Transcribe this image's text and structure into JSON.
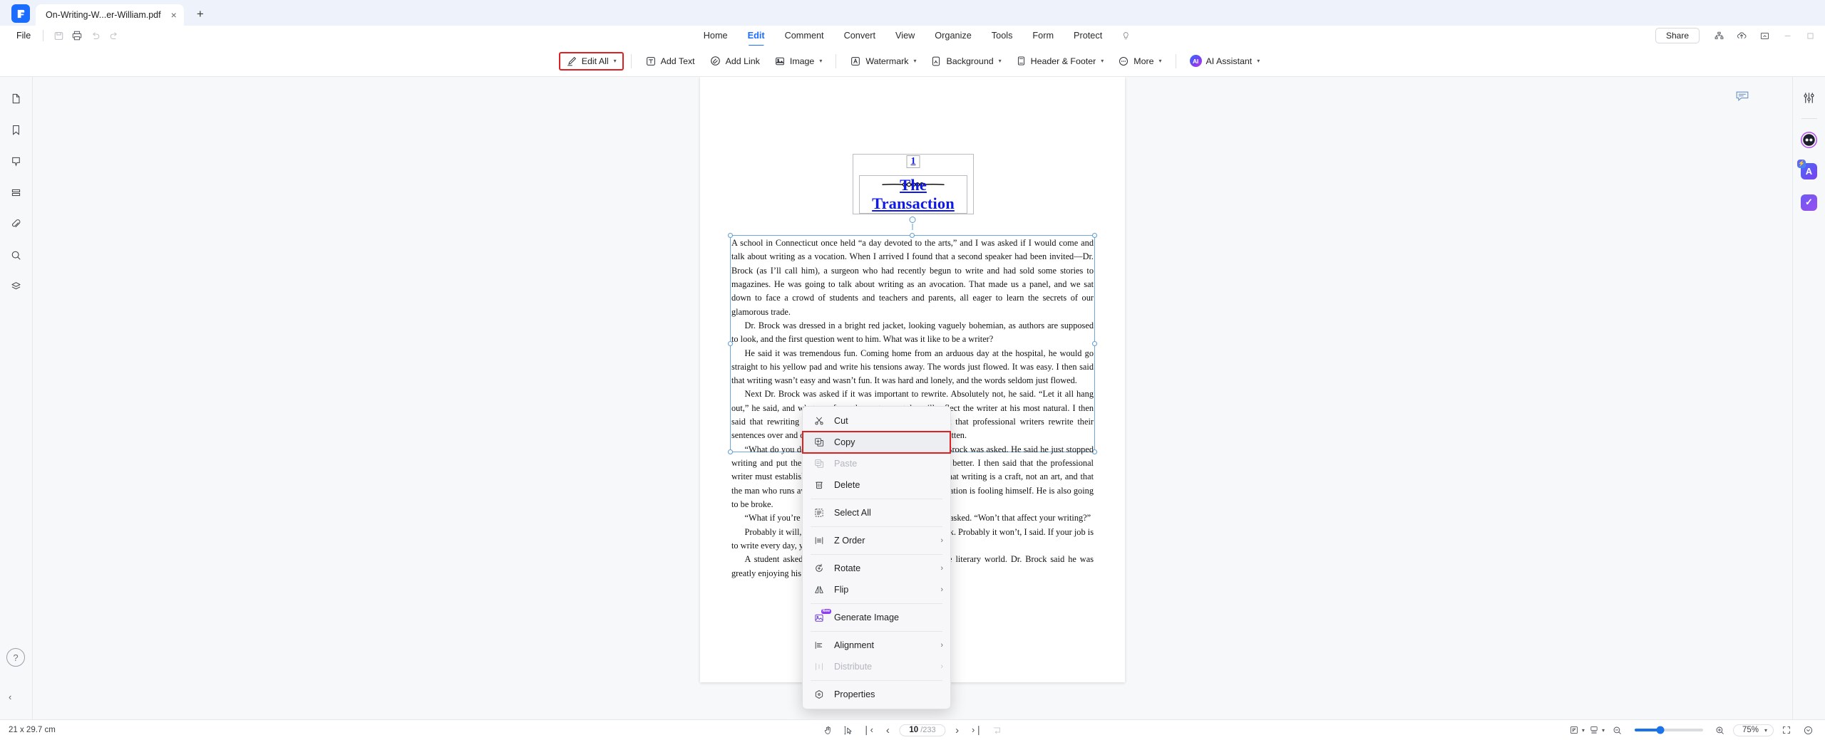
{
  "window": {
    "tab_title": "On-Writing-W...er-William.pdf",
    "close_label": "×",
    "new_tab_label": "+"
  },
  "menubar": {
    "file_label": "File",
    "quick_actions": [
      "save-icon",
      "print-icon",
      "undo-icon",
      "redo-icon"
    ],
    "tabs": [
      {
        "label": "Home",
        "active": false
      },
      {
        "label": "Edit",
        "active": true
      },
      {
        "label": "Comment",
        "active": false
      },
      {
        "label": "Convert",
        "active": false
      },
      {
        "label": "View",
        "active": false
      },
      {
        "label": "Organize",
        "active": false
      },
      {
        "label": "Tools",
        "active": false
      },
      {
        "label": "Form",
        "active": false
      },
      {
        "label": "Protect",
        "active": false
      }
    ],
    "tip_icon": "lightbulb-icon",
    "share_label": "Share",
    "window_icons": [
      "org-chart-icon",
      "cloud-upload-icon",
      "minimize-icon",
      "maximize-icon",
      "close-window-icon"
    ]
  },
  "toolbar": {
    "items": [
      {
        "label": "Edit All",
        "icon": "edit-pen-icon",
        "caret": true,
        "highlighted": true
      },
      {
        "label": "Add Text",
        "icon": "add-text-icon",
        "caret": false
      },
      {
        "label": "Add Link",
        "icon": "add-link-icon",
        "caret": false
      },
      {
        "label": "Image",
        "icon": "image-icon",
        "caret": true
      },
      {
        "label": "Watermark",
        "icon": "watermark-icon",
        "caret": true
      },
      {
        "label": "Background",
        "icon": "background-icon",
        "caret": true
      },
      {
        "label": "Header & Footer",
        "icon": "header-footer-icon",
        "caret": true
      },
      {
        "label": "More",
        "icon": "more-dots-icon",
        "caret": true
      },
      {
        "label": "AI Assistant",
        "icon": "ai-icon",
        "caret": true,
        "badge": "AI"
      }
    ]
  },
  "left_rail": {
    "items": [
      {
        "name": "thumbnails-icon"
      },
      {
        "name": "bookmark-icon"
      },
      {
        "name": "comment-icon"
      },
      {
        "name": "list-icon"
      },
      {
        "name": "attachment-icon"
      },
      {
        "name": "search-icon"
      },
      {
        "name": "layers-icon"
      }
    ],
    "help_label": "?",
    "collapse_label": "‹"
  },
  "right_rail": {
    "items": [
      {
        "name": "sliders-icon"
      },
      {
        "name": "ai-robot-icon"
      },
      {
        "name": "ai-translate-icon"
      },
      {
        "name": "ai-check-icon"
      }
    ],
    "float_chat": "chat-bubble-icon"
  },
  "document": {
    "page_number": "1",
    "ornament": "⁓∿⁓",
    "title": "The Transaction",
    "paragraphs": [
      "A school in Connecticut once held “a day devoted to the arts,” and I was asked if I would come and talk about writing as a vocation. When I arrived I found that a second speaker had been invited—Dr. Brock (as I’ll call him), a surgeon who had recently begun to write and had sold some stories to magazines. He was going to talk about writing as an avocation. That made us a panel, and we sat down to face a crowd of students and teachers and parents, all eager to learn the secrets of our glamorous trade.",
      "Dr. Brock was dressed in a bright red jacket, looking vaguely bohemian, as authors are supposed to look, and the first question went to him. What was it like to be a writer?",
      "He said it was tremendous fun. Coming home from an arduous day at the hospital, he would go straight to his yellow pad and write his tensions away. The words just flowed. It was easy. I then said that writing wasn’t easy and wasn’t fun. It was hard and lonely, and the words seldom just flowed.",
      "Next Dr. Brock was asked if it was important to rewrite. Absolutely not, he said. “Let it all hang out,” he said, and whatever form the sentences take will reflect the writer at his most natural. I then said that rewriting is the essence of writing. I pointed out that professional writers rewrite their sentences over and over and then rewrite what they have rewritten.",
      "“What do you do on days when it isn’t going well?” Dr. Brock was asked. He said he just stopped writing and put the work aside for a day when it would go better. I then said that the professional writer must establish a daily schedule and stick to it. I said that writing is a craft, not an art, and that the man who runs away from his craft because he lacks inspiration is fooling himself. He is also going to be broke.",
      "“What if you’re feeling depressed or unhappy?” a student asked. “Won’t that affect your writing?”",
      "Probably it will, Dr. Brock replied. Go fishing. Take a walk. Probably it won’t, I said. If your job is to write every day, you learn to do it like any other job.",
      "A student asked if we found it useful to circulate in the literary world. Dr. Brock said he was greatly enjoying his new life as a man of letters, and he told"
    ]
  },
  "context_menu": {
    "items": [
      {
        "label": "Cut",
        "icon": "scissors-icon",
        "disabled": false,
        "submenu": false,
        "highlighted": false
      },
      {
        "label": "Copy",
        "icon": "copy-icon",
        "disabled": false,
        "submenu": false,
        "highlighted": true,
        "boxed": true
      },
      {
        "label": "Paste",
        "icon": "paste-icon",
        "disabled": true,
        "submenu": false
      },
      {
        "label": "Delete",
        "icon": "trash-icon",
        "disabled": false,
        "submenu": false
      },
      {
        "label": "Select All",
        "icon": "select-all-icon",
        "disabled": false,
        "submenu": false
      },
      {
        "label": "Z Order",
        "icon": "z-order-icon",
        "disabled": false,
        "submenu": true
      },
      {
        "label": "Rotate",
        "icon": "rotate-icon",
        "disabled": false,
        "submenu": true
      },
      {
        "label": "Flip",
        "icon": "flip-icon",
        "disabled": false,
        "submenu": true
      },
      {
        "label": "Generate Image",
        "icon": "generate-image-icon",
        "disabled": false,
        "submenu": false,
        "badge": "New"
      },
      {
        "label": "Alignment",
        "icon": "alignment-icon",
        "disabled": false,
        "submenu": true
      },
      {
        "label": "Distribute",
        "icon": "distribute-icon",
        "disabled": true,
        "submenu": true
      },
      {
        "label": "Properties",
        "icon": "properties-icon",
        "disabled": false,
        "submenu": false
      }
    ],
    "arrow_glyph": "›"
  },
  "statusbar": {
    "page_size": "21 x 29.7 cm",
    "hand_tool": "hand-icon",
    "select_tool": "cursor-select-icon",
    "first_page": "❘‹",
    "prev_page": "‹",
    "current_page": "10",
    "total_pages": "/233",
    "next_page": "›",
    "last_page": "›❘",
    "fit_icon": "fit-page-icon",
    "view_mode_icon": "page-view-icon",
    "scroll_mode_icon": "scroll-mode-icon",
    "zoom_out": "−",
    "zoom_in": "+",
    "zoom_value": "75%",
    "zoom_caret": "⌄",
    "fullscreen_icon": "fullscreen-icon",
    "more_icon": "chevron-down-circle-icon"
  },
  "colors": {
    "accent": "#1a6dff",
    "highlight_box": "#e02020",
    "title_link": "#1019e8",
    "selection": "#5b9bd5"
  }
}
